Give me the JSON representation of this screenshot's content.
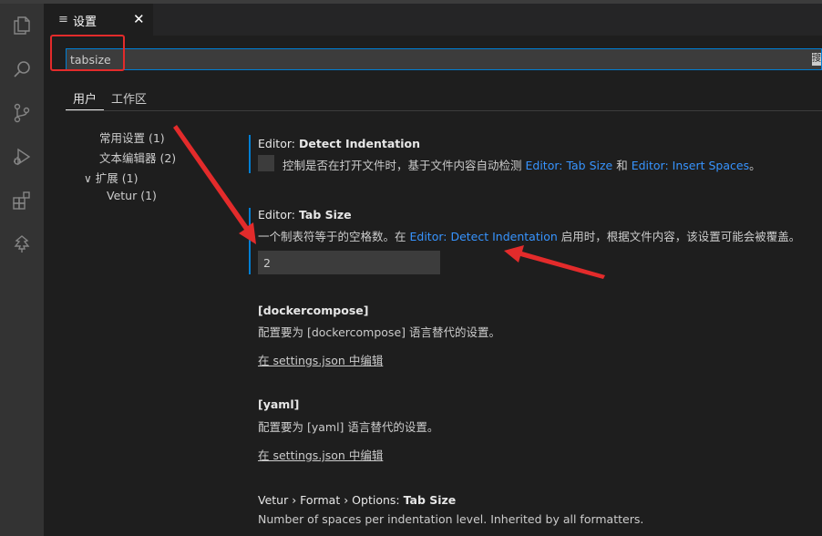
{
  "tab": {
    "label": "设置",
    "icon": "settings-lines-icon",
    "close": "✕"
  },
  "search": {
    "value": "tabsize",
    "placeholder": "",
    "right_glyph": "搜"
  },
  "scopes": {
    "user": "用户",
    "workspace": "工作区"
  },
  "toc": [
    {
      "label": "常用设置 (1)"
    },
    {
      "label": "文本编辑器 (2)"
    },
    {
      "label": "扩展 (1)",
      "chevron": "∨"
    },
    {
      "label": "Vetur (1)"
    }
  ],
  "settings": {
    "detect": {
      "prefix": "Editor: ",
      "name": "Detect Indentation",
      "desc_before": "控制是否在打开文件时，基于文件内容自动检测 ",
      "link1": "Editor: Tab Size",
      "desc_mid": " 和 ",
      "link2": "Editor: Insert Spaces",
      "desc_after": "。"
    },
    "tabsize": {
      "prefix": "Editor: ",
      "name": "Tab Size",
      "desc_before": "一个制表符等于的空格数。在 ",
      "link": "Editor: Detect Indentation",
      "desc_after": " 启用时，根据文件内容，该设置可能会被覆盖。",
      "value": "2"
    },
    "dockercompose": {
      "name": "[dockercompose]",
      "desc": "配置要为 [dockercompose] 语言替代的设置。",
      "edit": "在 settings.json 中编辑"
    },
    "yaml": {
      "name": "[yaml]",
      "desc": "配置要为 [yaml] 语言替代的设置。",
      "edit": "在 settings.json 中编辑"
    },
    "vetur": {
      "prefix": "Vetur › Format › Options: ",
      "name": "Tab Size",
      "desc": "Number of spaces per indentation level. Inherited by all formatters."
    }
  },
  "colors": {
    "accent": "#007fd4",
    "link": "#3794ff",
    "annotation": "#e32b2b"
  }
}
